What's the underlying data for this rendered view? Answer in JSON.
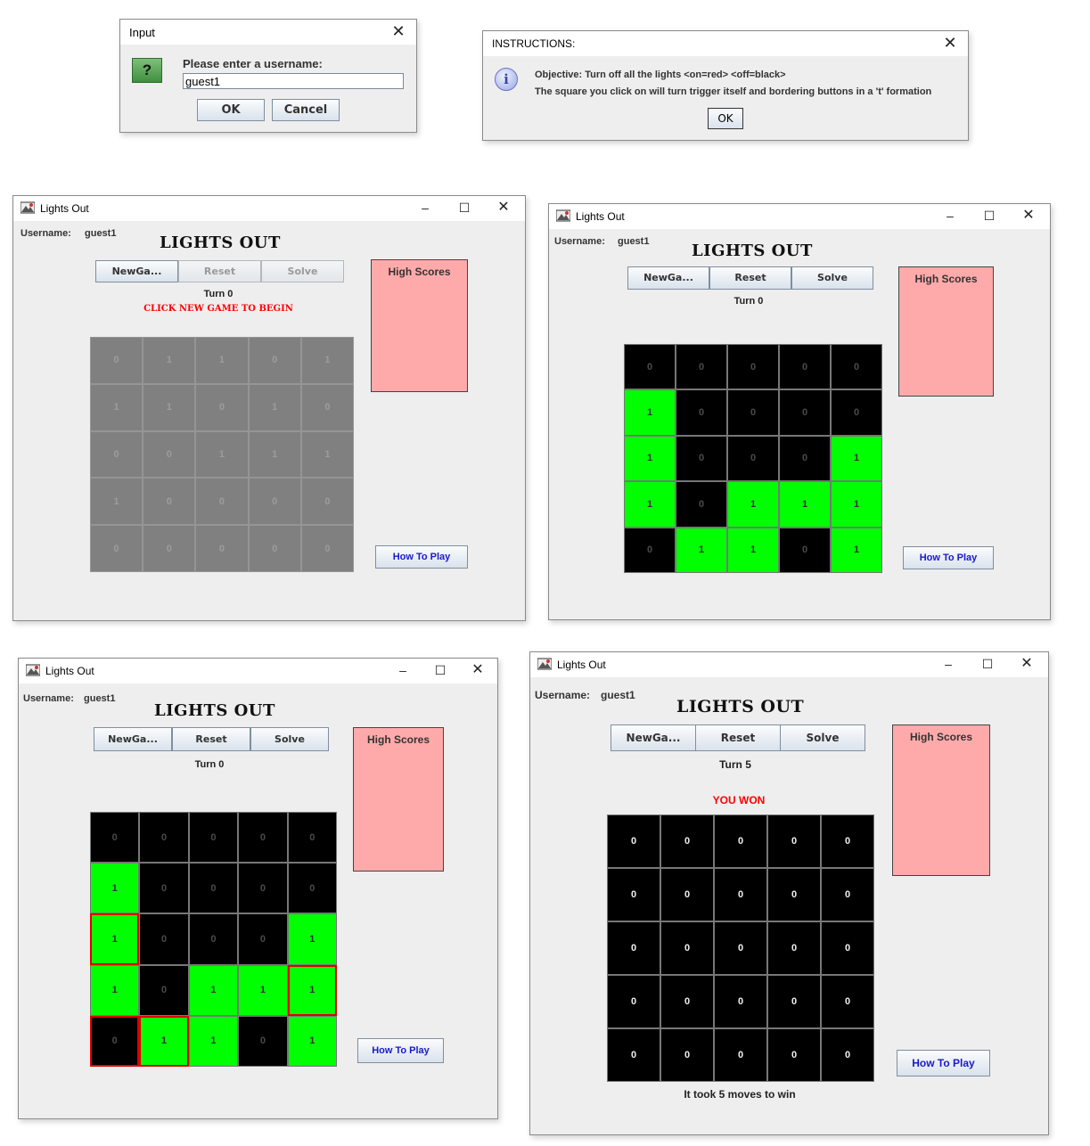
{
  "input_dialog": {
    "title": "Input",
    "icon": "question-icon",
    "prompt": "Please enter a username:",
    "value": "guest1",
    "ok_label": "OK",
    "cancel_label": "Cancel"
  },
  "instructions_dialog": {
    "title": "INSTRUCTIONS:",
    "icon": "info-icon",
    "line1": "Objective: Turn off all the lights <on=red> <off=black>",
    "line2": "The square you click on will turn trigger itself and bordering buttons in a 't' formation",
    "ok_label": "OK"
  },
  "windows": [
    {
      "title": "Lights Out",
      "username_label": "Username:",
      "username": "guest1",
      "game_title": "LIGHTS OUT",
      "buttons": [
        "NewGa...",
        "Reset",
        "Solve"
      ],
      "turn": "Turn 0",
      "message": "CLICK NEW GAME TO BEGIN",
      "high_scores": "High Scores",
      "how_to_play": "How To Play",
      "grid": [
        [
          "0",
          "1",
          "1",
          "0",
          "1"
        ],
        [
          "1",
          "1",
          "0",
          "1",
          "0"
        ],
        [
          "0",
          "0",
          "1",
          "1",
          "1"
        ],
        [
          "1",
          "0",
          "0",
          "0",
          "0"
        ],
        [
          "0",
          "0",
          "0",
          "0",
          "0"
        ]
      ]
    },
    {
      "title": "Lights Out",
      "username_label": "Username:",
      "username": "guest1",
      "game_title": "LIGHTS OUT",
      "buttons": [
        "NewGa...",
        "Reset",
        "Solve"
      ],
      "turn": "Turn 0",
      "high_scores": "High Scores",
      "how_to_play": "How To Play",
      "grid": [
        [
          "0",
          "0",
          "0",
          "0",
          "0"
        ],
        [
          "1",
          "0",
          "0",
          "0",
          "0"
        ],
        [
          "1",
          "0",
          "0",
          "0",
          "1"
        ],
        [
          "1",
          "0",
          "1",
          "1",
          "1"
        ],
        [
          "0",
          "1",
          "1",
          "0",
          "1"
        ]
      ]
    },
    {
      "title": "Lights Out",
      "username_label": "Username:",
      "username": "guest1",
      "game_title": "LIGHTS OUT",
      "buttons": [
        "NewGa...",
        "Reset",
        "Solve"
      ],
      "turn": "Turn 0",
      "high_scores": "High Scores",
      "how_to_play": "How To Play",
      "grid": [
        [
          "0",
          "0",
          "0",
          "0",
          "0"
        ],
        [
          "1",
          "0",
          "0",
          "0",
          "0"
        ],
        [
          "1",
          "0",
          "0",
          "0",
          "1"
        ],
        [
          "1",
          "0",
          "1",
          "1",
          "1"
        ],
        [
          "0",
          "1",
          "1",
          "0",
          "1"
        ]
      ],
      "highlighted_cells": [
        [
          2,
          0
        ],
        [
          3,
          4
        ],
        [
          4,
          0
        ],
        [
          4,
          1
        ]
      ]
    },
    {
      "title": "Lights Out",
      "username_label": "Username:",
      "username": "guest1",
      "game_title": "LIGHTS OUT",
      "buttons": [
        "NewGa...",
        "Reset",
        "Solve"
      ],
      "turn": "Turn 5",
      "message": "YOU WON",
      "high_scores": "High Scores",
      "how_to_play": "How To Play",
      "footer": "It took 5 moves to win",
      "grid": [
        [
          "0",
          "0",
          "0",
          "0",
          "0"
        ],
        [
          "0",
          "0",
          "0",
          "0",
          "0"
        ],
        [
          "0",
          "0",
          "0",
          "0",
          "0"
        ],
        [
          "0",
          "0",
          "0",
          "0",
          "0"
        ],
        [
          "0",
          "0",
          "0",
          "0",
          "0"
        ]
      ]
    }
  ],
  "colors": {
    "on": "#00ff00",
    "off": "#000000",
    "disabled_cell": "#808080",
    "high_scores_bg": "#ffaaaa",
    "message_red": "#ff0000",
    "highlight_border": "#e00000"
  }
}
